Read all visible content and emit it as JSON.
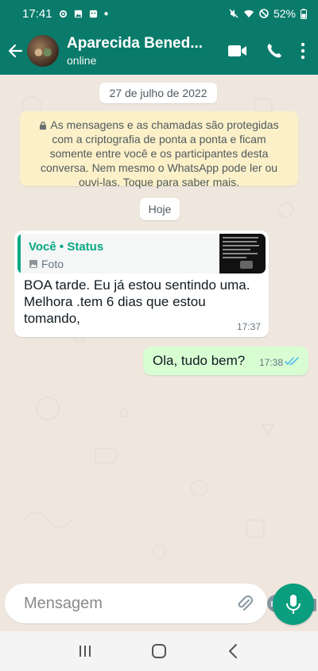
{
  "status_bar": {
    "time": "17:41",
    "battery": "52%"
  },
  "header": {
    "contact_name": "Aparecida Bened...",
    "contact_status": "online"
  },
  "chat": {
    "date_label": "27 de julho de 2022",
    "encryption_notice": "As mensagens e as chamadas são protegidas com a criptografia de ponta a ponta e ficam somente entre você e os participantes desta conversa. Nem mesmo o WhatsApp pode ler ou ouvi-las. Toque para saber mais.",
    "today_label": "Hoje",
    "messages": [
      {
        "direction": "incoming",
        "quoted_author": "Você • Status",
        "quoted_type": "Foto",
        "text": "BOA tarde. Eu  já estou sentindo uma. Melhora .tem 6  dias que estou tomando,",
        "time": "17:37"
      },
      {
        "direction": "outgoing",
        "text": "Ola, tudo bem?",
        "time": "17:38"
      }
    ]
  },
  "composer": {
    "placeholder": "Mensagem"
  },
  "colors": {
    "header": "#0a7b6b",
    "accent": "#06a884",
    "outgoing_bubble": "#d9fdd3",
    "system_bubble": "#fbf0c8",
    "chat_bg": "#efe7de",
    "read_ticks": "#53bdeb"
  },
  "icons": {
    "back": "arrow-left-icon",
    "video": "video-call-icon",
    "phone": "phone-icon",
    "menu": "more-vert-icon",
    "emoji": "emoji-icon",
    "attach": "paperclip-icon",
    "payment": "payment-icon",
    "camera": "camera-icon",
    "mic": "mic-icon"
  }
}
